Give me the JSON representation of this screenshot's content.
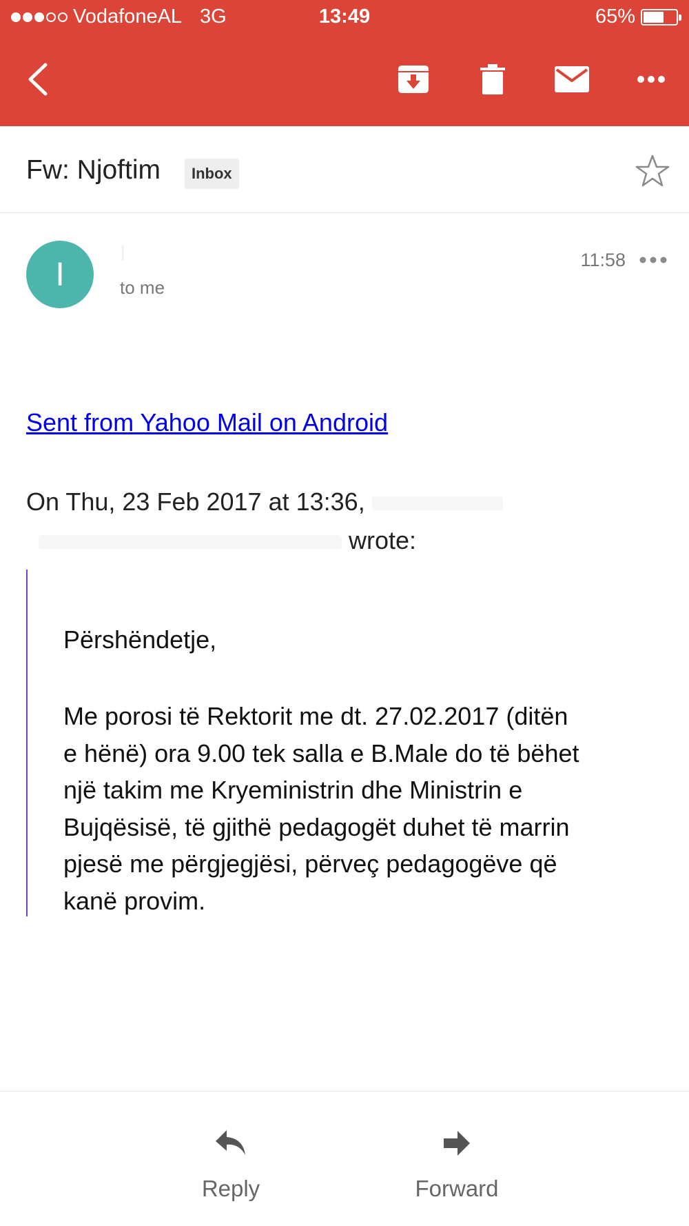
{
  "status_bar": {
    "carrier": "VodafoneAL",
    "network": "3G",
    "time": "13:49",
    "battery_percent": "65%",
    "battery_level": 0.65,
    "signal_bars_filled": 3,
    "signal_bars_total": 5
  },
  "toolbar": {
    "back_icon": "chevron-left-icon",
    "archive_icon": "archive-icon",
    "delete_icon": "trash-icon",
    "mark_unread_icon": "envelope-icon",
    "more_icon": "more-horizontal-icon",
    "background_color": "#db4437"
  },
  "email": {
    "subject": "Fw: Njoftim",
    "label": "Inbox",
    "sender_initial": "I",
    "sender_name": "I",
    "recipient": "to me",
    "time": "11:58",
    "avatar_color": "#4db6ac",
    "signature_link": "Sent from Yahoo Mail on Android",
    "quote_header_prefix": "On Thu, 23 Feb 2017 at 13:36,",
    "quote_header_suffix": "wrote:",
    "greeting": "Përshëndetje,",
    "body": "Me porosi të Rektorit me dt. 27.02.2017 (ditën\ne hënë) ora 9.00 tek salla e B.Male do të bëhet\nnjë takim me Kryeministrin dhe Ministrin e\nBujqësisë, të gjithë pedagogët duhet të marrin\n pjesë me përgjegjësi, përveç pedagogëve që\nkanë provim."
  },
  "actions": {
    "reply_label": "Reply",
    "forward_label": "Forward"
  }
}
